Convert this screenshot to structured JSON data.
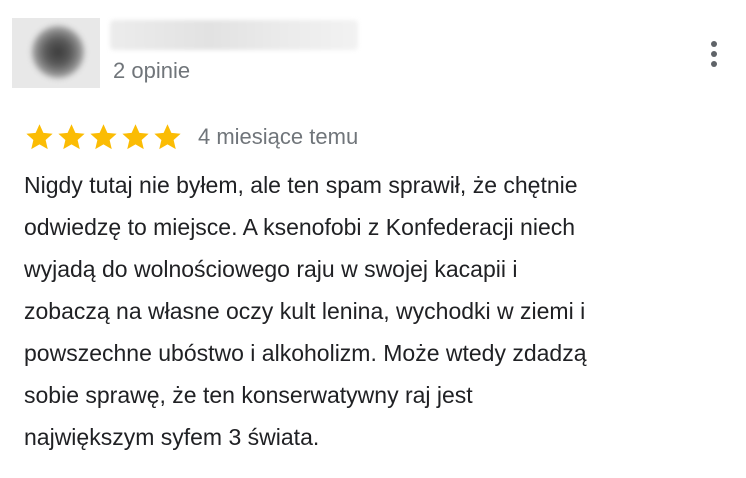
{
  "review": {
    "reviewer": {
      "name_redacted": true,
      "review_count": "2 opinie"
    },
    "rating": {
      "stars": 5,
      "max_stars": 5,
      "star_color": "#fbbc04"
    },
    "time_ago": "4 miesiące temu",
    "text": "Nigdy tutaj nie byłem, ale ten spam sprawił, że chętnie\nodwiedzę to miejsce. A ksenofobi z Konfederacji niech\nwyjadą do wolnościowego raju w swojej kacapii i\nzobaczą na własne oczy kult lenina, wychodki w ziemi i\npowszechne ubóstwo i alkoholizm. Może wtedy zdadzą\nsobie sprawę, że ten konserwatywny raj jest\nnajwiększym syfem 3 świata.",
    "menu_icon": "more-vert-icon"
  }
}
